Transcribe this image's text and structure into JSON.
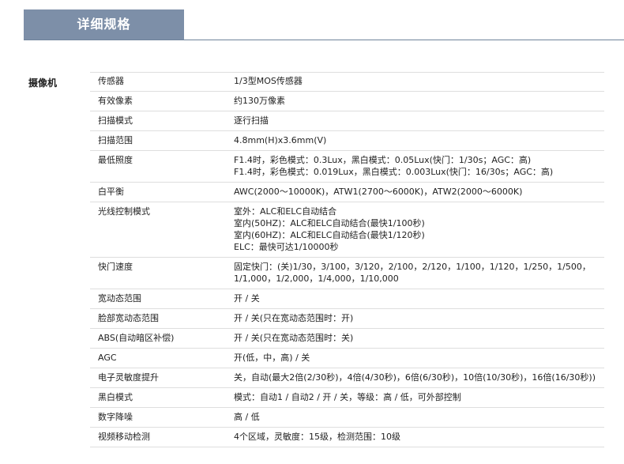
{
  "title": "详细规格",
  "category": "摄像机",
  "rows": [
    {
      "key": "传感器",
      "values": [
        "1/3型MOS传感器"
      ]
    },
    {
      "key": "有效像素",
      "values": [
        "约130万像素"
      ]
    },
    {
      "key": "扫描模式",
      "values": [
        "逐行扫描"
      ]
    },
    {
      "key": "扫描范围",
      "values": [
        "4.8mm(H)x3.6mm(V)"
      ]
    },
    {
      "key": "最低照度",
      "values": [
        "F1.4时，彩色模式：0.3Lux，黑白模式：0.05Lux(快门：1/30s；AGC：高)",
        "F1.4时，彩色模式：0.019Lux，黑白模式：0.003Lux(快门：16/30s；AGC：高)"
      ]
    },
    {
      "key": "白平衡",
      "values": [
        "AWC(2000～10000K)，ATW1(2700～6000K)，ATW2(2000～6000K)"
      ]
    },
    {
      "key": "光线控制模式",
      "values": [
        "室外：ALC和ELC自动结合",
        "室内(50HZ)：ALC和ELC自动结合(最快1/100秒)",
        "室内(60HZ)：ALC和ELC自动结合(最快1/120秒)",
        "ELC：最快可达1/10000秒"
      ]
    },
    {
      "key": "快门速度",
      "values": [
        "固定快门：(关)1/30，3/100，3/120，2/100，2/120，1/100，1/120，1/250，1/500，1/1,000，1/2,000，1/4,000，1/10,000"
      ]
    },
    {
      "key": "宽动态范围",
      "values": [
        "开 / 关"
      ]
    },
    {
      "key": "脸部宽动态范围",
      "values": [
        "开 / 关(只在宽动态范围时：开)"
      ]
    },
    {
      "key": "ABS(自动暗区补偿)",
      "values": [
        "开 / 关(只在宽动态范围时：关)"
      ]
    },
    {
      "key": "AGC",
      "values": [
        "开(低，中，高) / 关"
      ]
    },
    {
      "key": "电子灵敏度提升",
      "values": [
        "关，自动(最大2倍(2/30秒)，4倍(4/30秒)，6倍(6/30秒)，10倍(10/30秒)，16倍(16/30秒))"
      ]
    },
    {
      "key": "黑白模式",
      "values": [
        "模式：自动1 / 自动2 / 开 / 关，等级：高 / 低，可外部控制"
      ]
    },
    {
      "key": "数字降噪",
      "values": [
        "高 / 低"
      ]
    },
    {
      "key": "视频移动检测",
      "values": [
        "4个区域，灵敏度：15级，检测范围：10级"
      ]
    }
  ]
}
